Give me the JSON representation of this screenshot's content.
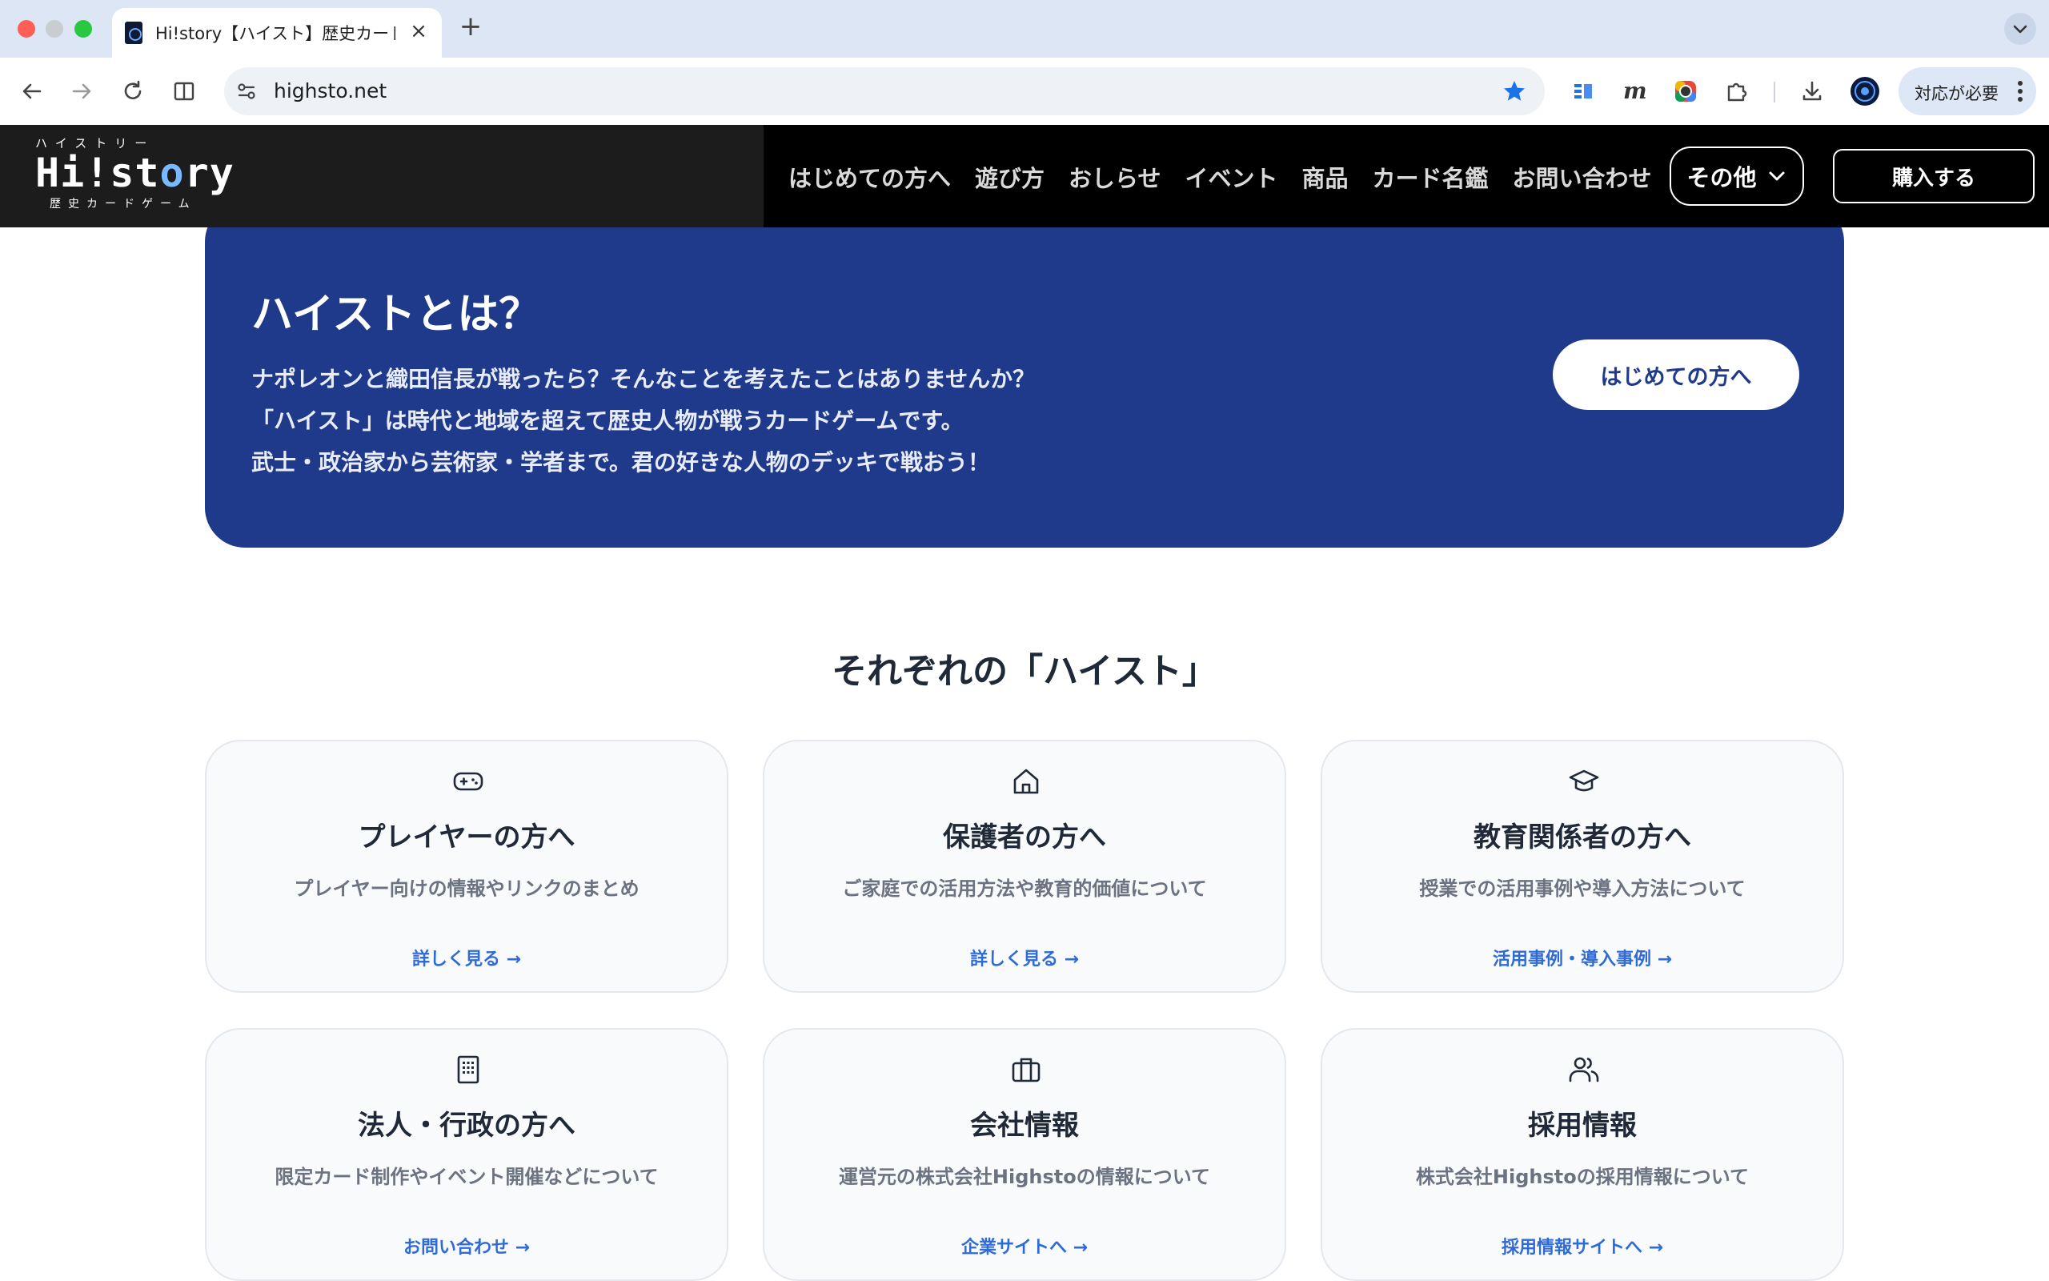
{
  "browser": {
    "tab_title": "Hi!story【ハイスト】歴史カード",
    "new_tab": "+",
    "tab_close": "×",
    "url": "highsto.net",
    "profile_label": "対応が必要"
  },
  "site": {
    "logo_kana": "ハイストリー",
    "logo_main_left": "Hi!st",
    "logo_main_o": "o",
    "logo_main_right": "ry",
    "logo_sub": "歴史カードゲーム",
    "nav": [
      "はじめての方へ",
      "遊び方",
      "おしらせ",
      "イベント",
      "商品",
      "カード名鑑",
      "お問い合わせ"
    ],
    "other_label": "その他",
    "buy_label": "購入する"
  },
  "hero": {
    "title": "ハイストとは？",
    "lines": [
      "ナポレオンと織田信長が戦ったら？そんなことを考えたことはありませんか？",
      "「ハイスト」は時代と地域を超えて歴史人物が戦うカードゲームです。",
      "武士・政治家から芸術家・学者まで。君の好きな人物のデッキで戦おう！"
    ],
    "button": "はじめての方へ"
  },
  "section_title": "それぞれの「ハイスト」",
  "cards": [
    {
      "icon": "gamepad-icon",
      "title": "プレイヤーの方へ",
      "desc": "プレイヤー向けの情報やリンクのまとめ",
      "link": "詳しく見る →"
    },
    {
      "icon": "home-icon",
      "title": "保護者の方へ",
      "desc": "ご家庭での活用方法や教育的価値について",
      "link": "詳しく見る →"
    },
    {
      "icon": "graduation-cap-icon",
      "title": "教育関係者の方へ",
      "desc": "授業での活用事例や導入方法について",
      "link": "活用事例・導入事例 →"
    },
    {
      "icon": "building-icon",
      "title": "法人・行政の方へ",
      "desc": "限定カード制作やイベント開催などについて",
      "link": "お問い合わせ →"
    },
    {
      "icon": "briefcase-icon",
      "title": "会社情報",
      "desc": "運営元の株式会社Highstoの情報について",
      "link": "企業サイトへ →"
    },
    {
      "icon": "users-icon",
      "title": "採用情報",
      "desc": "株式会社Highstoの採用情報について",
      "link": "採用情報サイトへ →"
    }
  ],
  "colors": {
    "hero_bg": "#1f3a8a",
    "link_blue": "#2f6bd6",
    "header_bg": "#000000"
  }
}
